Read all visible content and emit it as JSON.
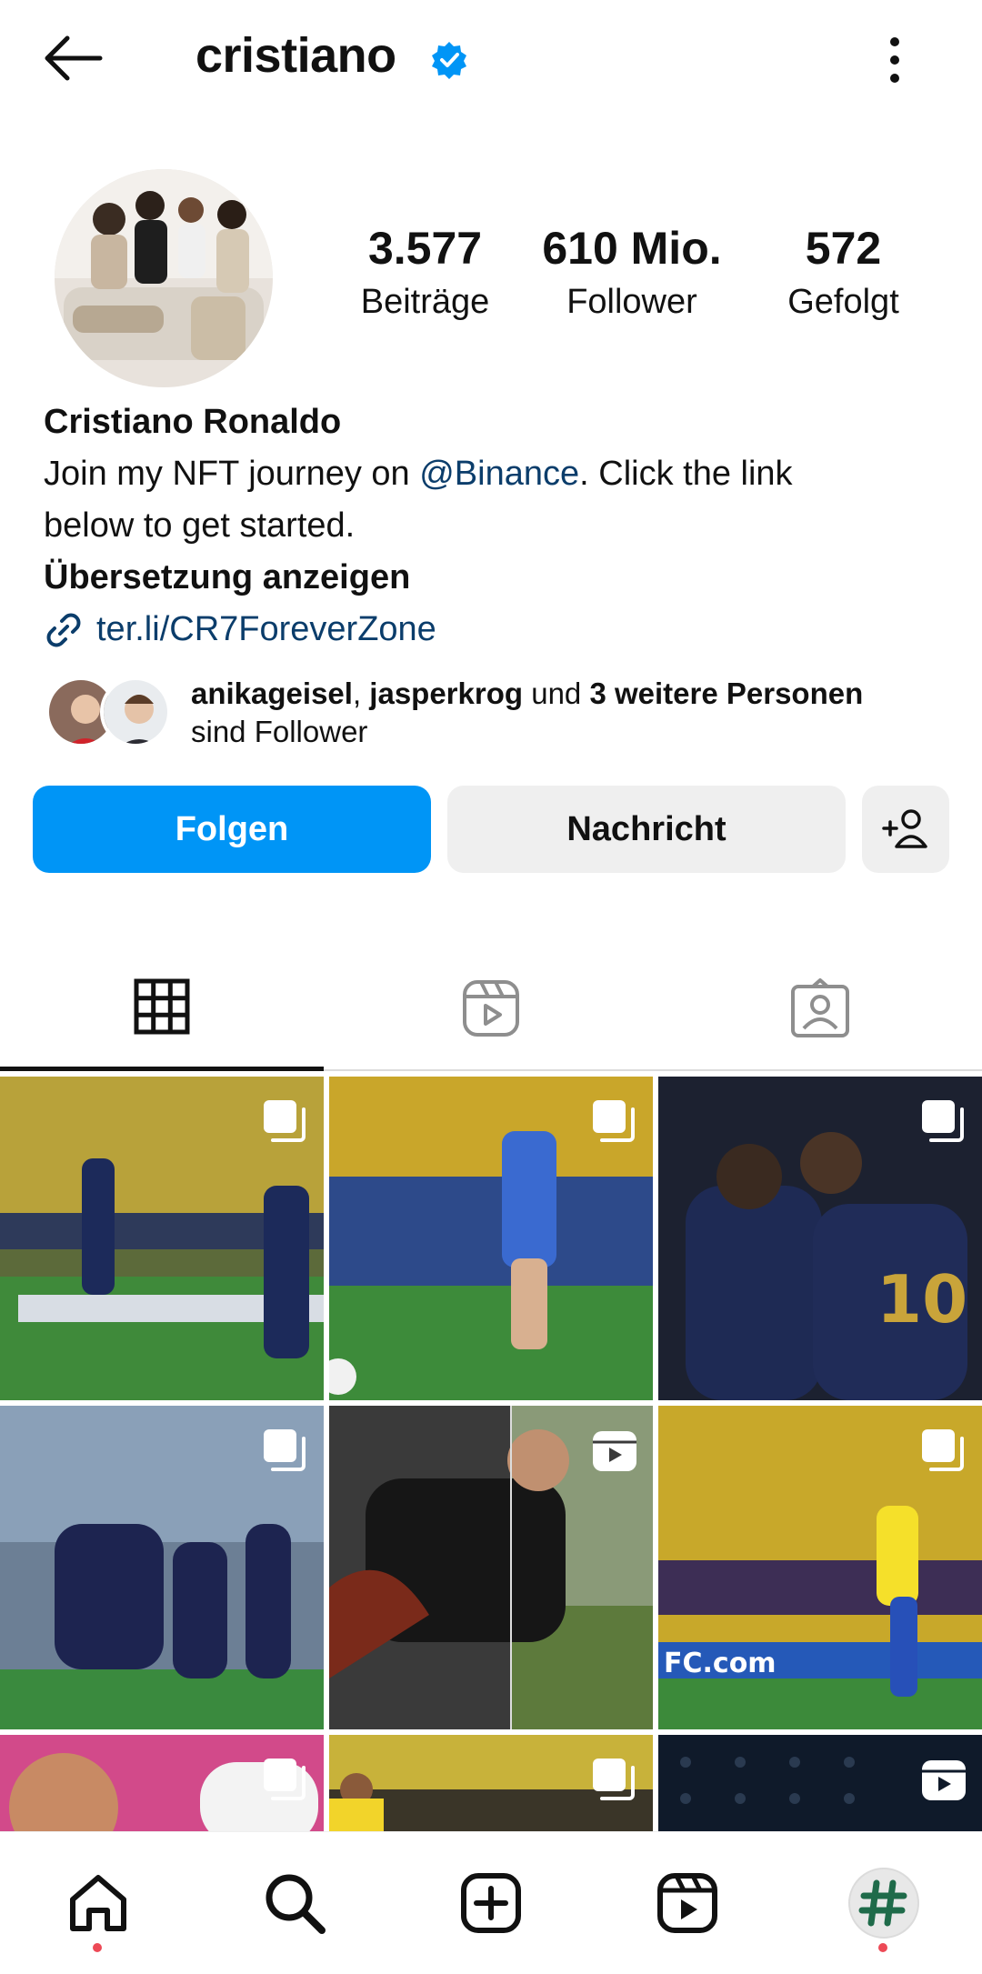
{
  "header": {
    "username": "cristiano",
    "verified_icon": "verified-badge-icon",
    "back_icon": "arrow-left-icon",
    "menu_icon": "more-vertical-icon"
  },
  "profile": {
    "stats": [
      {
        "value": "3.577",
        "label": "Beiträge"
      },
      {
        "value": "610 Mio.",
        "label": "Follower"
      },
      {
        "value": "572",
        "label": "Gefolgt"
      }
    ],
    "full_name": "Cristiano Ronaldo",
    "bio_prefix": "Join my NFT journey on ",
    "bio_mention": "@Binance",
    "bio_suffix_1": ". Click the link",
    "bio_suffix_2": "below to get started.",
    "translate_label": "Übersetzung anzeigen",
    "link": "ter.li/CR7ForeverZone"
  },
  "followed_by": {
    "user1": "anikageisel",
    "separator": ", ",
    "user2": "jasperkrog",
    "connector": " und ",
    "others": "3 weitere Personen",
    "suffix": "sind Follower"
  },
  "actions": {
    "follow_label": "Folgen",
    "message_label": "Nachricht",
    "add_user_icon": "add-user-icon"
  },
  "tabs": [
    {
      "icon": "grid-icon",
      "active": true
    },
    {
      "icon": "reels-icon",
      "active": false
    },
    {
      "icon": "tagged-icon",
      "active": false
    }
  ],
  "bottom_nav": [
    {
      "icon": "home-icon"
    },
    {
      "icon": "search-icon"
    },
    {
      "icon": "create-icon"
    },
    {
      "icon": "reels-icon"
    },
    {
      "icon": "profile-hashtag-icon"
    }
  ],
  "colors": {
    "accent": "#0095f6",
    "link": "#0b3d6b",
    "notification_dot": "#ed4956"
  }
}
